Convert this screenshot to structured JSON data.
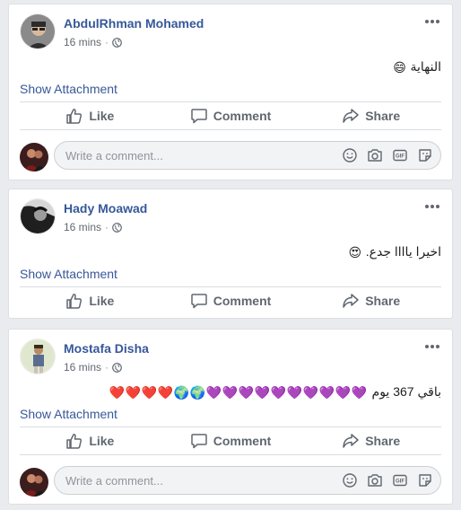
{
  "posts": [
    {
      "author": "AbdulRhman Mohamed",
      "time": "16 mins",
      "message": "النهاية",
      "message_emoji": "😄",
      "attachment_label": "Show Attachment",
      "actions": {
        "like": "Like",
        "comment": "Comment",
        "share": "Share"
      },
      "composer_placeholder": "Write a comment...",
      "avatar_colors": [
        "#7a7a7a",
        "#3a3a3a"
      ]
    },
    {
      "author": "Hady Moawad",
      "time": "16 mins",
      "message": "اخيرا ياااا جدع.",
      "message_emoji": "😍",
      "attachment_label": "Show Attachment",
      "actions": {
        "like": "Like",
        "comment": "Comment",
        "share": "Share"
      },
      "avatar_colors": [
        "#cfcfcf",
        "#222222"
      ]
    },
    {
      "author": "Mostafa Disha",
      "time": "16 mins",
      "message": "باقي 367 يوم",
      "message_emojis": [
        "💜",
        "💜",
        "💜",
        "💜",
        "💜",
        "💜",
        "💜",
        "💜",
        "💜",
        "💜",
        "🌍",
        "🌍",
        "❤️",
        "❤️",
        "❤️",
        "❤️"
      ],
      "attachment_label": "Show Attachment",
      "actions": {
        "like": "Like",
        "comment": "Comment",
        "share": "Share"
      },
      "composer_placeholder": "Write a comment...",
      "avatar_colors": [
        "#d8e3c5",
        "#5a6b8a"
      ]
    }
  ],
  "colors": {
    "link": "#385898",
    "name": "#365899",
    "action_text": "#606770",
    "background": "#e9ebee"
  },
  "icons": [
    "globe-icon",
    "more-options-icon",
    "like-icon",
    "comment-icon",
    "share-icon",
    "emoji-icon",
    "camera-icon",
    "gif-icon",
    "sticker-icon"
  ]
}
